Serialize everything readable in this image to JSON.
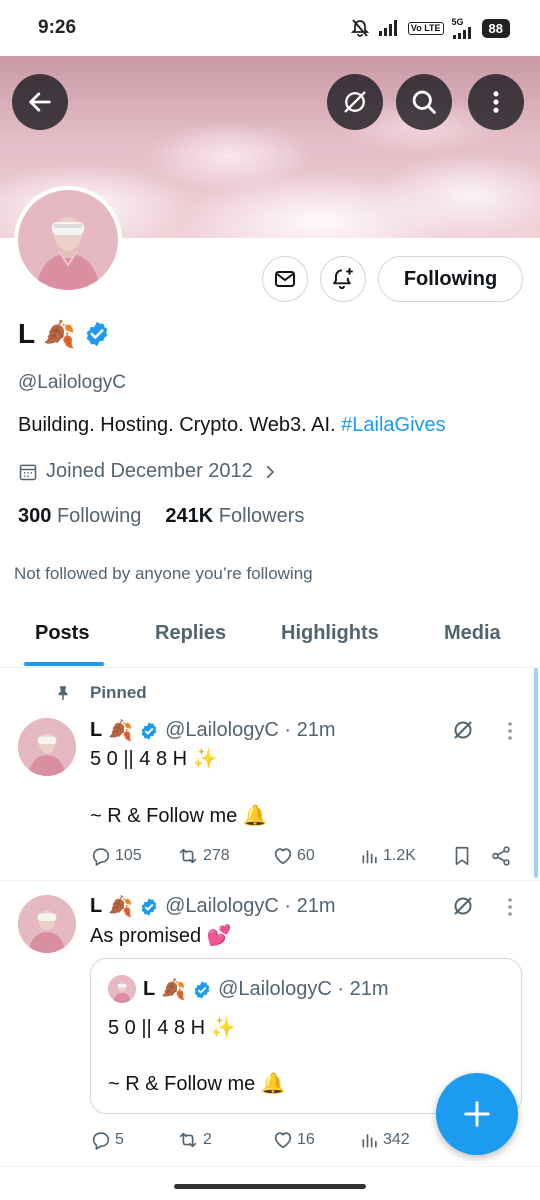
{
  "status_bar": {
    "time": "9:26",
    "network": "5G",
    "volte": "Vo LTE",
    "battery": "88"
  },
  "profile": {
    "display_name": "L",
    "name_emoji": "🍂",
    "handle": "@LailologyC",
    "bio_text": "Building. Hosting. Crypto. Web3. AI.",
    "bio_hashtag": "#LailaGives",
    "joined": "Joined December 2012",
    "following_count": "300",
    "following_label": "Following",
    "followers_count": "241K",
    "followers_label": "Followers",
    "not_followed": "Not followed by anyone you’re following",
    "follow_button": "Following"
  },
  "tabs": [
    {
      "label": "Posts",
      "active": true
    },
    {
      "label": "Replies"
    },
    {
      "label": "Highlights"
    },
    {
      "label": "Media"
    }
  ],
  "posts": [
    {
      "pinned_label": "Pinned",
      "name": "L",
      "emoji": "🍂",
      "meta": "@LailologyC · 21m",
      "line1": "5 0 || 4 8 H ✨",
      "line2": "~ R & Follow me 🔔",
      "replies": "105",
      "reposts": "278",
      "likes": "60",
      "views": "1.2K"
    },
    {
      "name": "L",
      "emoji": "🍂",
      "meta": "@LailologyC · 21m",
      "text": "As promised 💕",
      "quote": {
        "name": "L",
        "emoji": "🍂",
        "meta": "@LailologyC · 21m",
        "line1": "5 0 || 4 8 H ✨",
        "line2": "~ R & Follow me 🔔"
      },
      "replies": "5",
      "reposts": "2",
      "likes": "16",
      "views": "342"
    }
  ],
  "colors": {
    "accent": "#1d9bf0",
    "secondary_text": "#536471",
    "banner": "#e3bcc6"
  }
}
